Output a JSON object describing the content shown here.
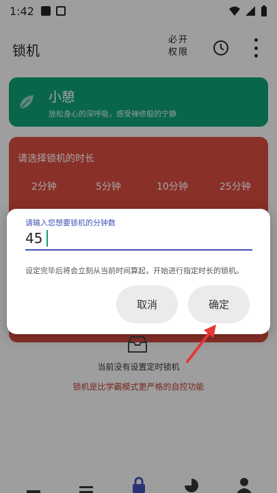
{
  "status": {
    "time": "1:42"
  },
  "appbar": {
    "title": "锁机",
    "permission_label": "必开权限",
    "clock_icon": "clock-icon",
    "more_icon": "more-vert-icon"
  },
  "relax": {
    "title": "小憩",
    "subtitle": "放松身心的深呼吸，感受禅修般的宁静",
    "icon": "leaf-icon"
  },
  "lock": {
    "title": "请选择锁机的时长",
    "durations": [
      "2分钟",
      "5分钟",
      "10分钟",
      "25分钟"
    ]
  },
  "empty_state": {
    "text": "当前没有设置定时锁机"
  },
  "hint": {
    "text": "锁机是比学霸模式更严格的自控功能"
  },
  "dialog": {
    "label": "请输入您想要锁机的分钟数",
    "value": "45",
    "description": "设定完毕后将会立刻从当前时间算起，开始进行指定时长的锁机。",
    "cancel": "取消",
    "confirm": "确定"
  },
  "colors": {
    "green": "#0e9d72",
    "red": "#d34a3e",
    "accent": "#3f51b5",
    "arrow": "#e53935"
  }
}
